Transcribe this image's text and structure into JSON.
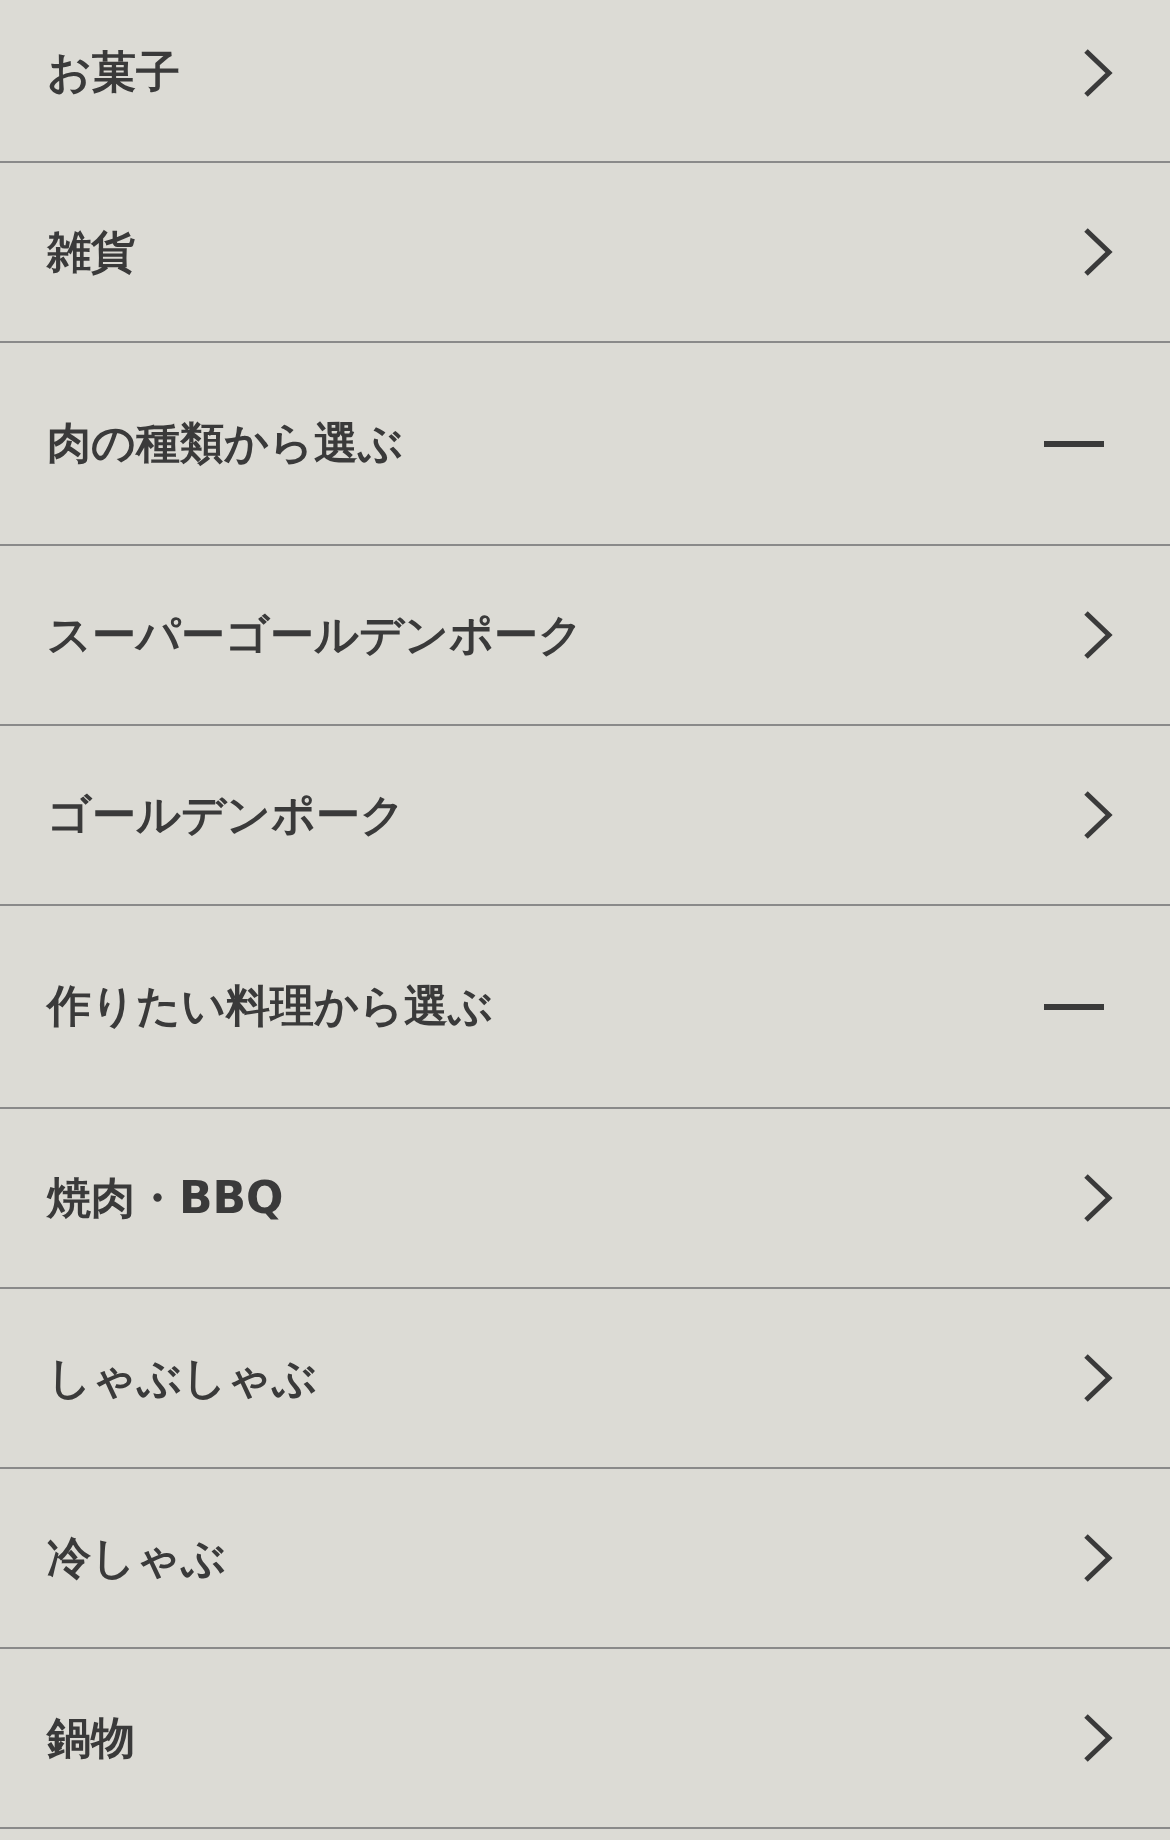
{
  "menu": [
    {
      "kind": "link",
      "label": "お菓子"
    },
    {
      "kind": "link",
      "label": "雑貨"
    },
    {
      "kind": "section",
      "label": "肉の種類から選ぶ",
      "expanded": true
    },
    {
      "kind": "link",
      "label": "スーパーゴールデンポーク"
    },
    {
      "kind": "link",
      "label": "ゴールデンポーク"
    },
    {
      "kind": "section",
      "label": "作りたい料理から選ぶ",
      "expanded": true
    },
    {
      "kind": "link",
      "label": "焼肉・BBQ"
    },
    {
      "kind": "link",
      "label": "しゃぶしゃぶ"
    },
    {
      "kind": "link",
      "label": "冷しゃぶ"
    },
    {
      "kind": "link",
      "label": "鍋物"
    }
  ]
}
